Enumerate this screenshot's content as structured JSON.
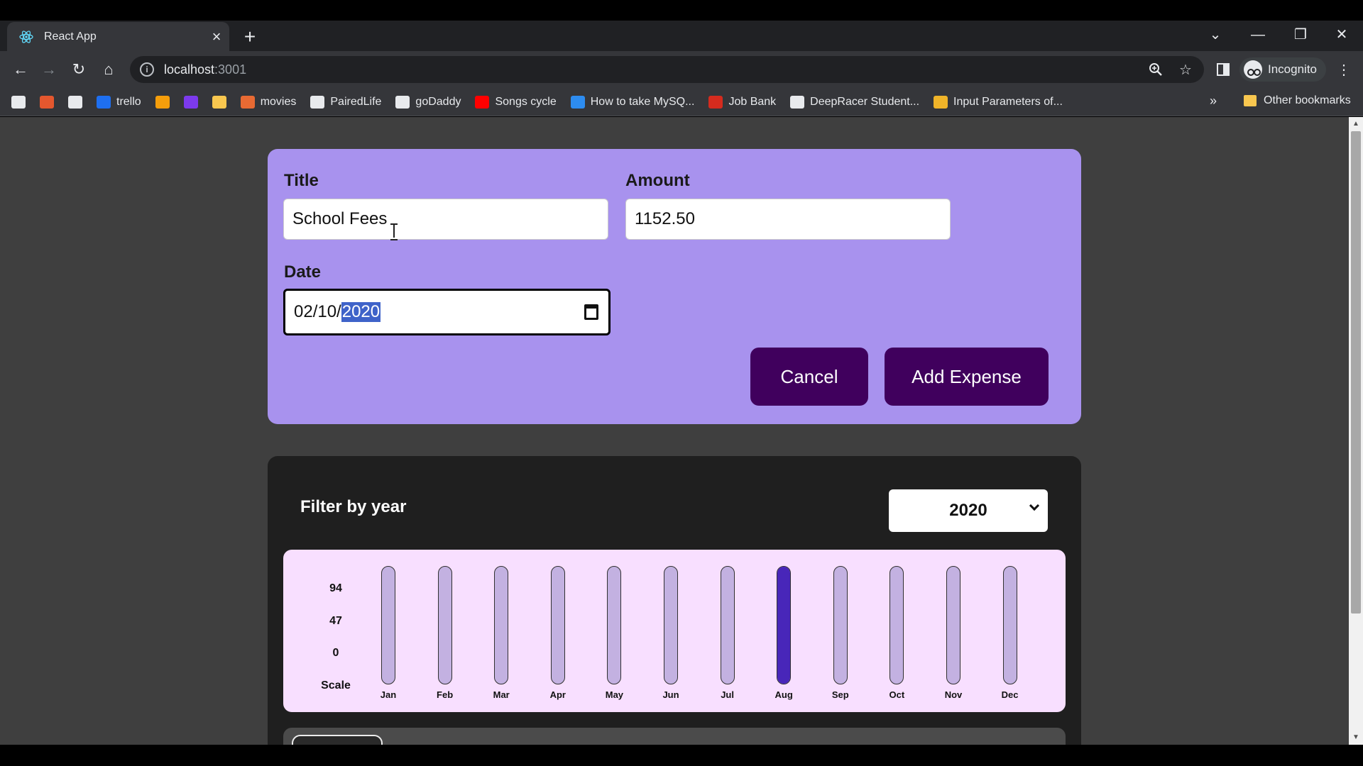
{
  "browser": {
    "tab_title": "React App",
    "url_host": "localhost",
    "url_port": ":3001",
    "profile_label": "Incognito",
    "bookmarks": [
      {
        "label": "",
        "icon": "briefcase-icon",
        "color": "#e8eaed"
      },
      {
        "label": "",
        "icon": "red-chevron-icon",
        "color": "#e4572e"
      },
      {
        "label": "",
        "icon": "ticket-icon",
        "color": "#e8eaed"
      },
      {
        "label": "trello",
        "icon": "trello-icon",
        "color": "#1e6ff0"
      },
      {
        "label": "",
        "icon": "infinity-icon",
        "color": "#f59e0b"
      },
      {
        "label": "",
        "icon": "bolt-icon",
        "color": "#7c3aed"
      },
      {
        "label": "",
        "icon": "folder-icon",
        "color": "#f9c74f"
      },
      {
        "label": "movies",
        "icon": "movies-icon",
        "color": "#e86a33"
      },
      {
        "label": "PairedLife",
        "icon": "pairedlife-icon",
        "color": "#e8eaed"
      },
      {
        "label": "goDaddy",
        "icon": "godaddy-icon",
        "color": "#e8eaed"
      },
      {
        "label": "Songs cycle",
        "icon": "youtube-icon",
        "color": "#ff0000"
      },
      {
        "label": "How to take MySQ...",
        "icon": "cloud-icon",
        "color": "#2d8cf0"
      },
      {
        "label": "Job Bank",
        "icon": "maple-leaf-icon",
        "color": "#d52b1e"
      },
      {
        "label": "DeepRacer Student...",
        "icon": "deepracer-icon",
        "color": "#e8eaed"
      },
      {
        "label": "Input Parameters of...",
        "icon": "package-icon",
        "color": "#f0b429"
      }
    ],
    "more_bookmarks": "»",
    "other_bookmarks": "Other bookmarks"
  },
  "form": {
    "title_label": "Title",
    "title_value": "School Fees",
    "amount_label": "Amount",
    "amount_value": "1152.50",
    "date_label": "Date",
    "date_prefix": "02/10/",
    "date_selected": "2020",
    "cancel_label": "Cancel",
    "submit_label": "Add Expense"
  },
  "filter": {
    "label": "Filter by year",
    "selected_year": "2020"
  },
  "chart_data": {
    "type": "bar",
    "scale_ticks": [
      "94",
      "47",
      "0"
    ],
    "scale_label": "Scale",
    "ylim": [
      0,
      94
    ],
    "categories": [
      "Jan",
      "Feb",
      "Mar",
      "Apr",
      "May",
      "Jun",
      "Jul",
      "Aug",
      "Sep",
      "Oct",
      "Nov",
      "Dec"
    ],
    "values": [
      0,
      0,
      0,
      0,
      0,
      0,
      0,
      94,
      0,
      0,
      0,
      0
    ],
    "bar_color": "#4826b9",
    "track_color": "#c3b1e1"
  },
  "colors": {
    "form_bg": "#a892ee",
    "button_bg": "#40005d",
    "expenses_bg": "#1f1f1f",
    "chart_bg": "#f8dfff"
  }
}
